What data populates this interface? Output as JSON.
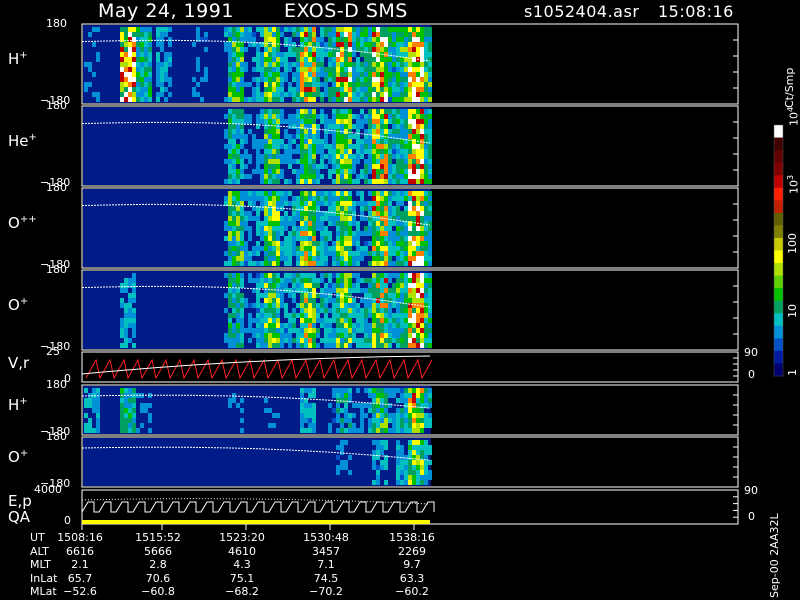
{
  "header": {
    "date": "May 24, 1991",
    "instrument": "EXOS-D SMS",
    "filename": "s1052404.asr",
    "time": "15:08:16"
  },
  "chart_data": [
    {
      "type": "heatmap",
      "panel_label": "H",
      "panel_label_sup": "+",
      "ylim_labels": [
        "180",
        "−180"
      ]
    },
    {
      "type": "heatmap",
      "panel_label": "He",
      "panel_label_sup": "+",
      "ylim_labels": [
        "180",
        "−180"
      ]
    },
    {
      "type": "heatmap",
      "panel_label": "O",
      "panel_label_sup": "++",
      "ylim_labels": [
        "180",
        "−180"
      ]
    },
    {
      "type": "heatmap",
      "panel_label": "O",
      "panel_label_sup": "+",
      "ylim_labels": [
        "180",
        "−180"
      ]
    },
    {
      "type": "line",
      "panel_label": "V,r",
      "ylim_labels": [
        "25",
        "0"
      ],
      "right_labels": [
        "90",
        "0"
      ]
    },
    {
      "type": "heatmap",
      "panel_label": "H",
      "panel_label_sup": "+",
      "ylim_labels": [
        "180",
        "−180"
      ]
    },
    {
      "type": "heatmap",
      "panel_label": "O",
      "panel_label_sup": "+",
      "ylim_labels": [
        "180",
        "−180"
      ]
    },
    {
      "type": "line",
      "panel_label": "E,p",
      "panel_label2": "QA",
      "ylim_labels": [
        "4000",
        "0"
      ],
      "right_labels": [
        "90",
        "0"
      ]
    }
  ],
  "colorbar": {
    "unit": "Ct/Smp",
    "ticks": [
      {
        "base": "10",
        "exp": "4"
      },
      {
        "base": "10",
        "exp": "3"
      },
      {
        "base": "100",
        "exp": ""
      },
      {
        "base": "10",
        "exp": ""
      },
      {
        "base": "1",
        "exp": ""
      }
    ],
    "colors": [
      "#000070",
      "#001aa0",
      "#0050c8",
      "#0090d8",
      "#00c0c0",
      "#00a060",
      "#00c000",
      "#60d000",
      "#b0e000",
      "#ffff00",
      "#c8c800",
      "#808000",
      "#606000",
      "#c02000",
      "#ff2000",
      "#c00000",
      "#800000",
      "#600000",
      "#400000",
      "#ffffff"
    ]
  },
  "xaxis": {
    "rows": [
      {
        "label": "UT",
        "values": [
          "1508:16",
          "1515:52",
          "1523:20",
          "1530:48",
          "1538:16"
        ]
      },
      {
        "label": "ALT",
        "values": [
          "6616",
          "5666",
          "4610",
          "3457",
          "2269"
        ]
      },
      {
        "label": "MLT",
        "values": [
          "2.1",
          "2.8",
          "4.3",
          "7.1",
          "9.7"
        ]
      },
      {
        "label": "InLat",
        "values": [
          "65.7",
          "70.6",
          "75.1",
          "74.5",
          "63.3"
        ]
      },
      {
        "label": "MLat",
        "values": [
          "−52.6",
          "−60.8",
          "−68.2",
          "−70.2",
          "−60.2"
        ]
      }
    ]
  },
  "footer": {
    "stamp": "Sep-00 2AA32L"
  }
}
